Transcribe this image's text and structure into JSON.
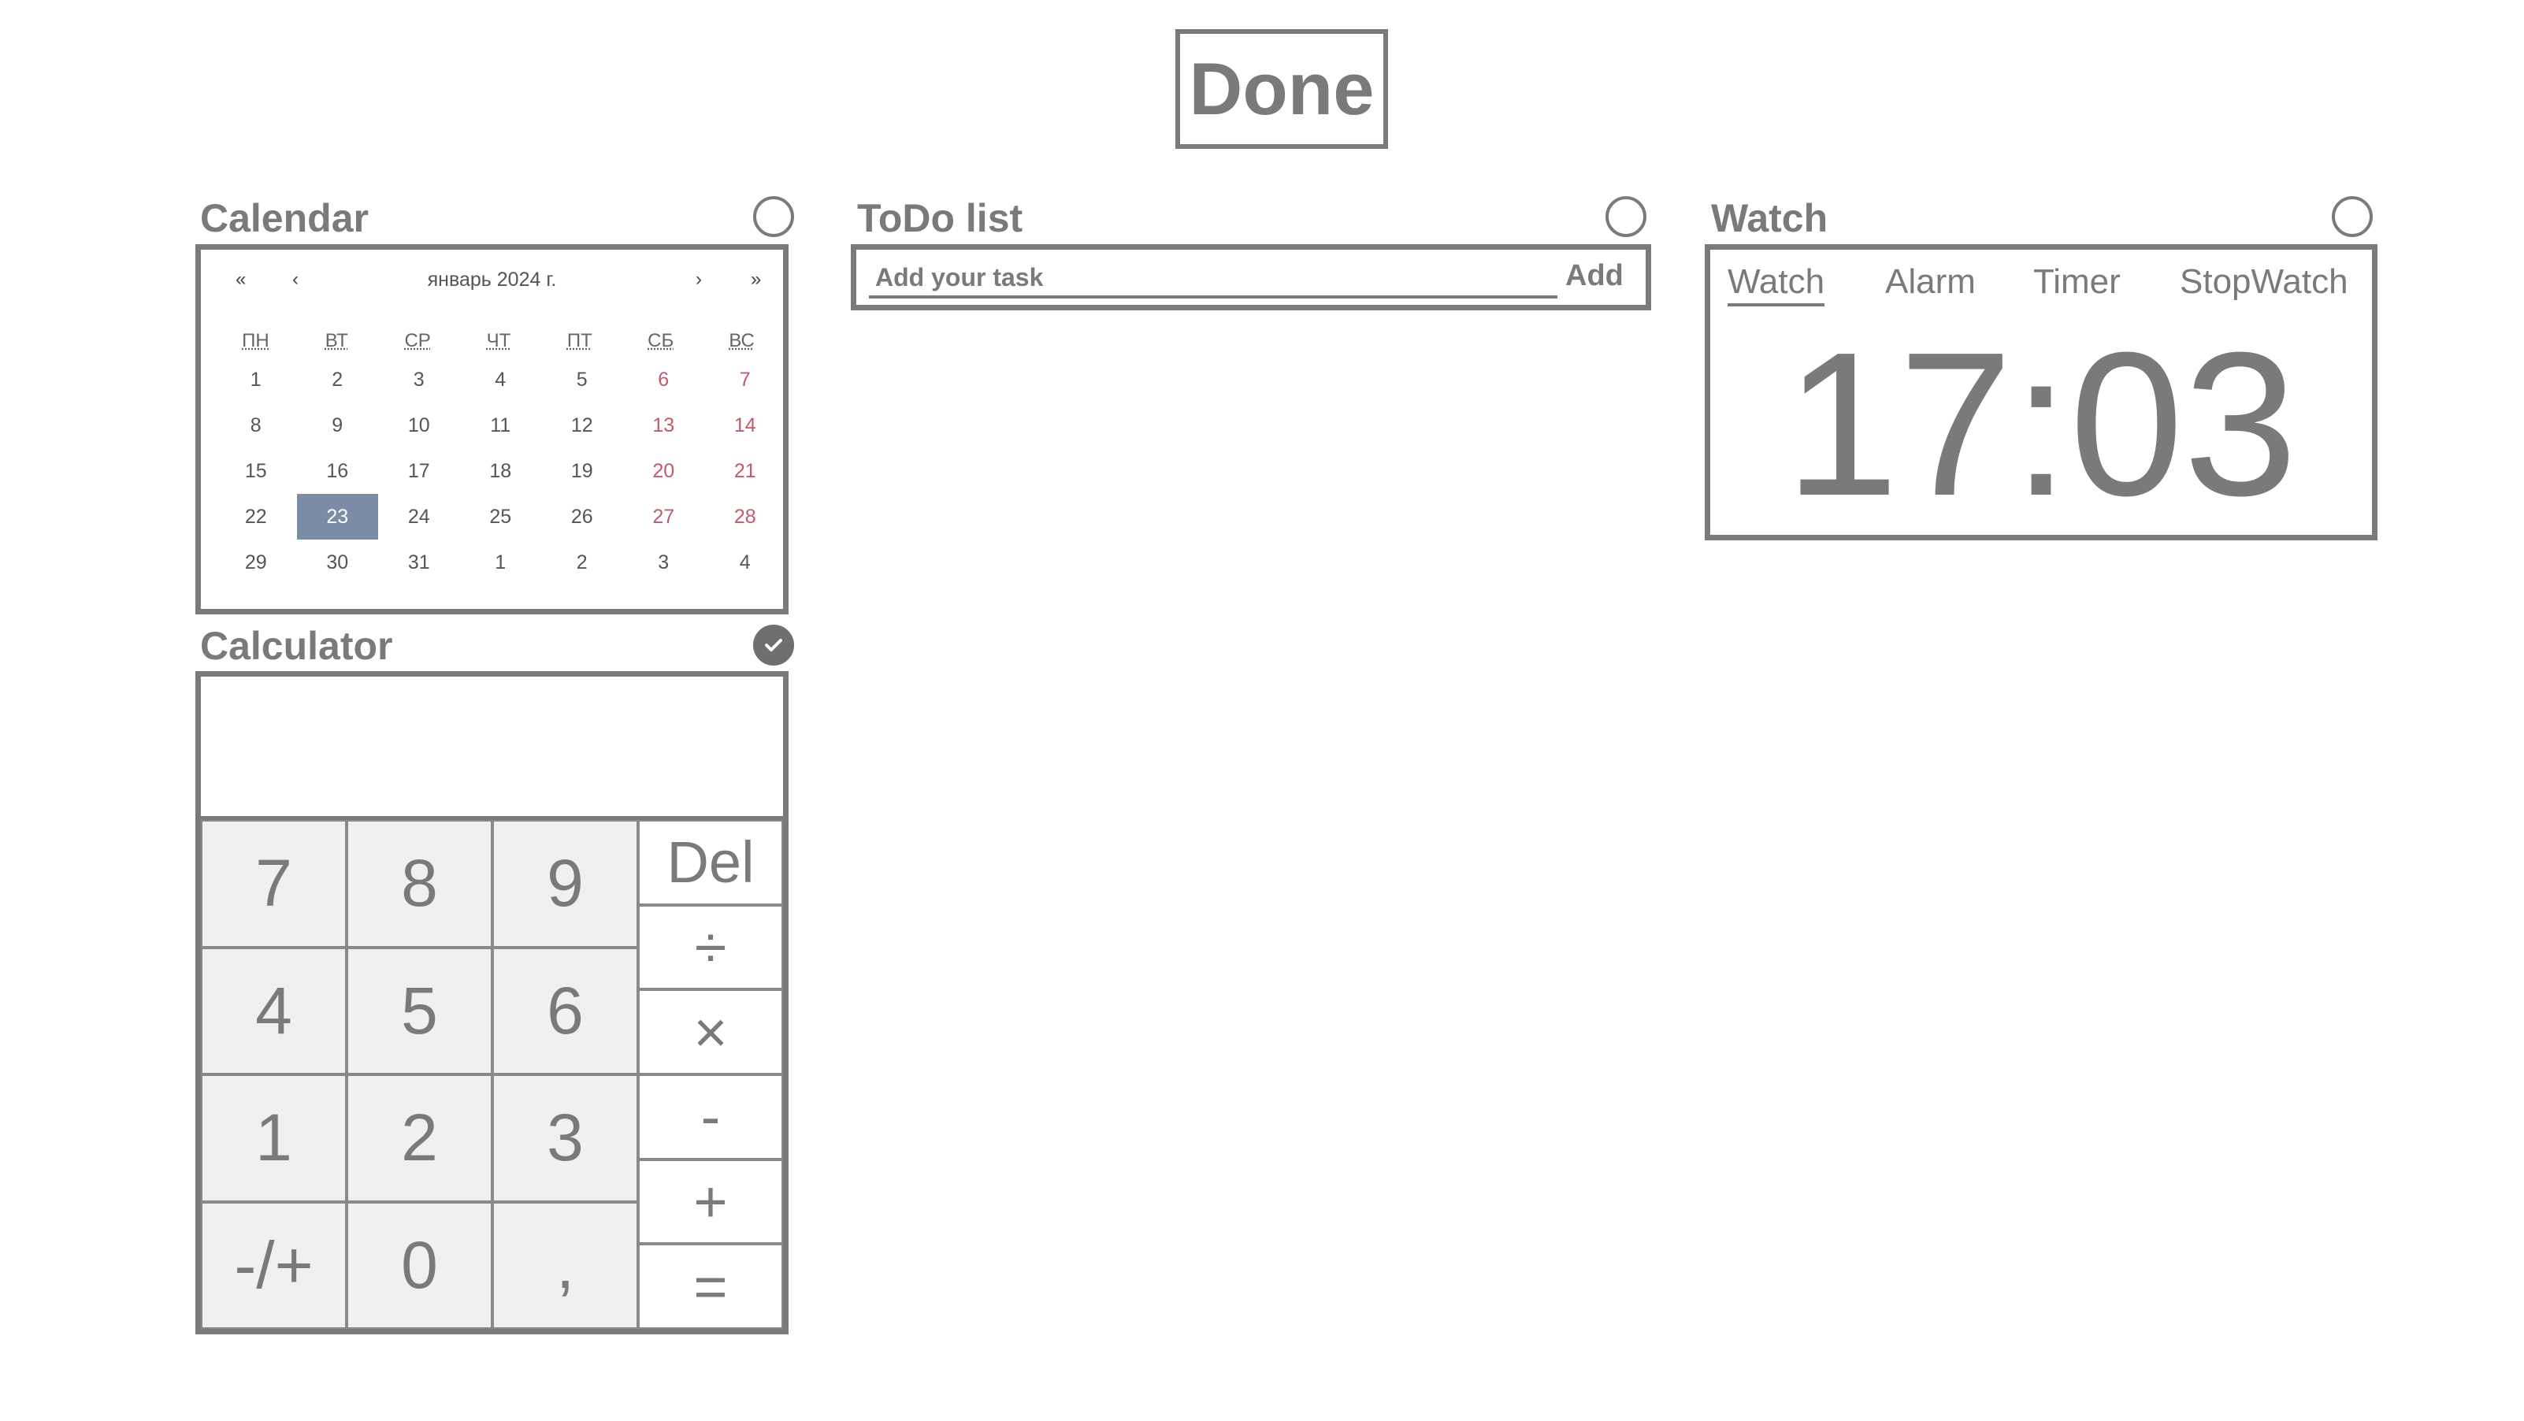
{
  "header": {
    "done_label": "Done"
  },
  "calendar": {
    "title": "Calendar",
    "month_label": "январь 2024 г.",
    "nav": {
      "prev_year": "«",
      "prev_month": "‹",
      "next_month": "›",
      "next_year": "»"
    },
    "weekdays": [
      "ПН",
      "ВТ",
      "СР",
      "ЧТ",
      "ПТ",
      "СБ",
      "ВС"
    ],
    "weeks": [
      [
        "1",
        "2",
        "3",
        "4",
        "5",
        "6",
        "7"
      ],
      [
        "8",
        "9",
        "10",
        "11",
        "12",
        "13",
        "14"
      ],
      [
        "15",
        "16",
        "17",
        "18",
        "19",
        "20",
        "21"
      ],
      [
        "22",
        "23",
        "24",
        "25",
        "26",
        "27",
        "28"
      ],
      [
        "29",
        "30",
        "31",
        "1",
        "2",
        "3",
        "4"
      ]
    ],
    "selected_day": "23",
    "colors": {
      "weekend": "#c25a6c",
      "selected_bg": "#7b8ca8"
    }
  },
  "todo": {
    "title": "ToDo list",
    "input_placeholder": "Add your task",
    "add_label": "Add"
  },
  "watch": {
    "title": "Watch",
    "tabs": [
      "Watch",
      "Alarm",
      "Timer",
      "StopWatch"
    ],
    "active_tab": "Watch",
    "time": "17:03"
  },
  "calculator": {
    "title": "Calculator",
    "display": "",
    "digit_keys": [
      [
        "7",
        "8",
        "9"
      ],
      [
        "4",
        "5",
        "6"
      ],
      [
        "1",
        "2",
        "3"
      ],
      [
        "-/+",
        "0",
        ","
      ]
    ],
    "op_keys": [
      "Del",
      "÷",
      "×",
      "-",
      "+",
      "="
    ]
  },
  "checkboxes": {
    "calendar": false,
    "todo": false,
    "watch": false,
    "calculator": true
  },
  "colors": {
    "primary": "#7a7a7a",
    "background": "#ffffff"
  }
}
